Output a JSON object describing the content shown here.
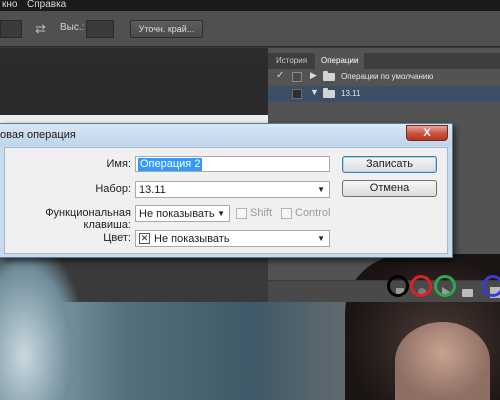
{
  "menubar": {
    "left_label": "кно",
    "right_label": "Справка"
  },
  "options_bar": {
    "height_label": "Выс.:",
    "refine_button": "Уточн. край..."
  },
  "panel": {
    "tabs": [
      {
        "label": "История"
      },
      {
        "label": "Операции"
      }
    ],
    "rows": [
      {
        "label": "Операции по умолчанию",
        "checked": true,
        "expanded": false
      },
      {
        "label": "13.11",
        "checked": false,
        "expanded": true
      }
    ]
  },
  "dialog": {
    "title": "овая операция",
    "close_label": "X",
    "name_label": "Имя:",
    "name_value": "Операция 2",
    "set_label": "Набор:",
    "set_value": "13.11",
    "fkey_label": "Функциональная клавиша:",
    "fkey_value": "Не показывать",
    "shift_label": "Shift",
    "control_label": "Control",
    "color_label": "Цвет:",
    "color_value": "Не показывать",
    "record_button": "Записать",
    "cancel_button": "Отмена"
  },
  "highlight_colors": [
    "#000000",
    "#e02020",
    "#2da84a",
    "#3a3ad8"
  ]
}
